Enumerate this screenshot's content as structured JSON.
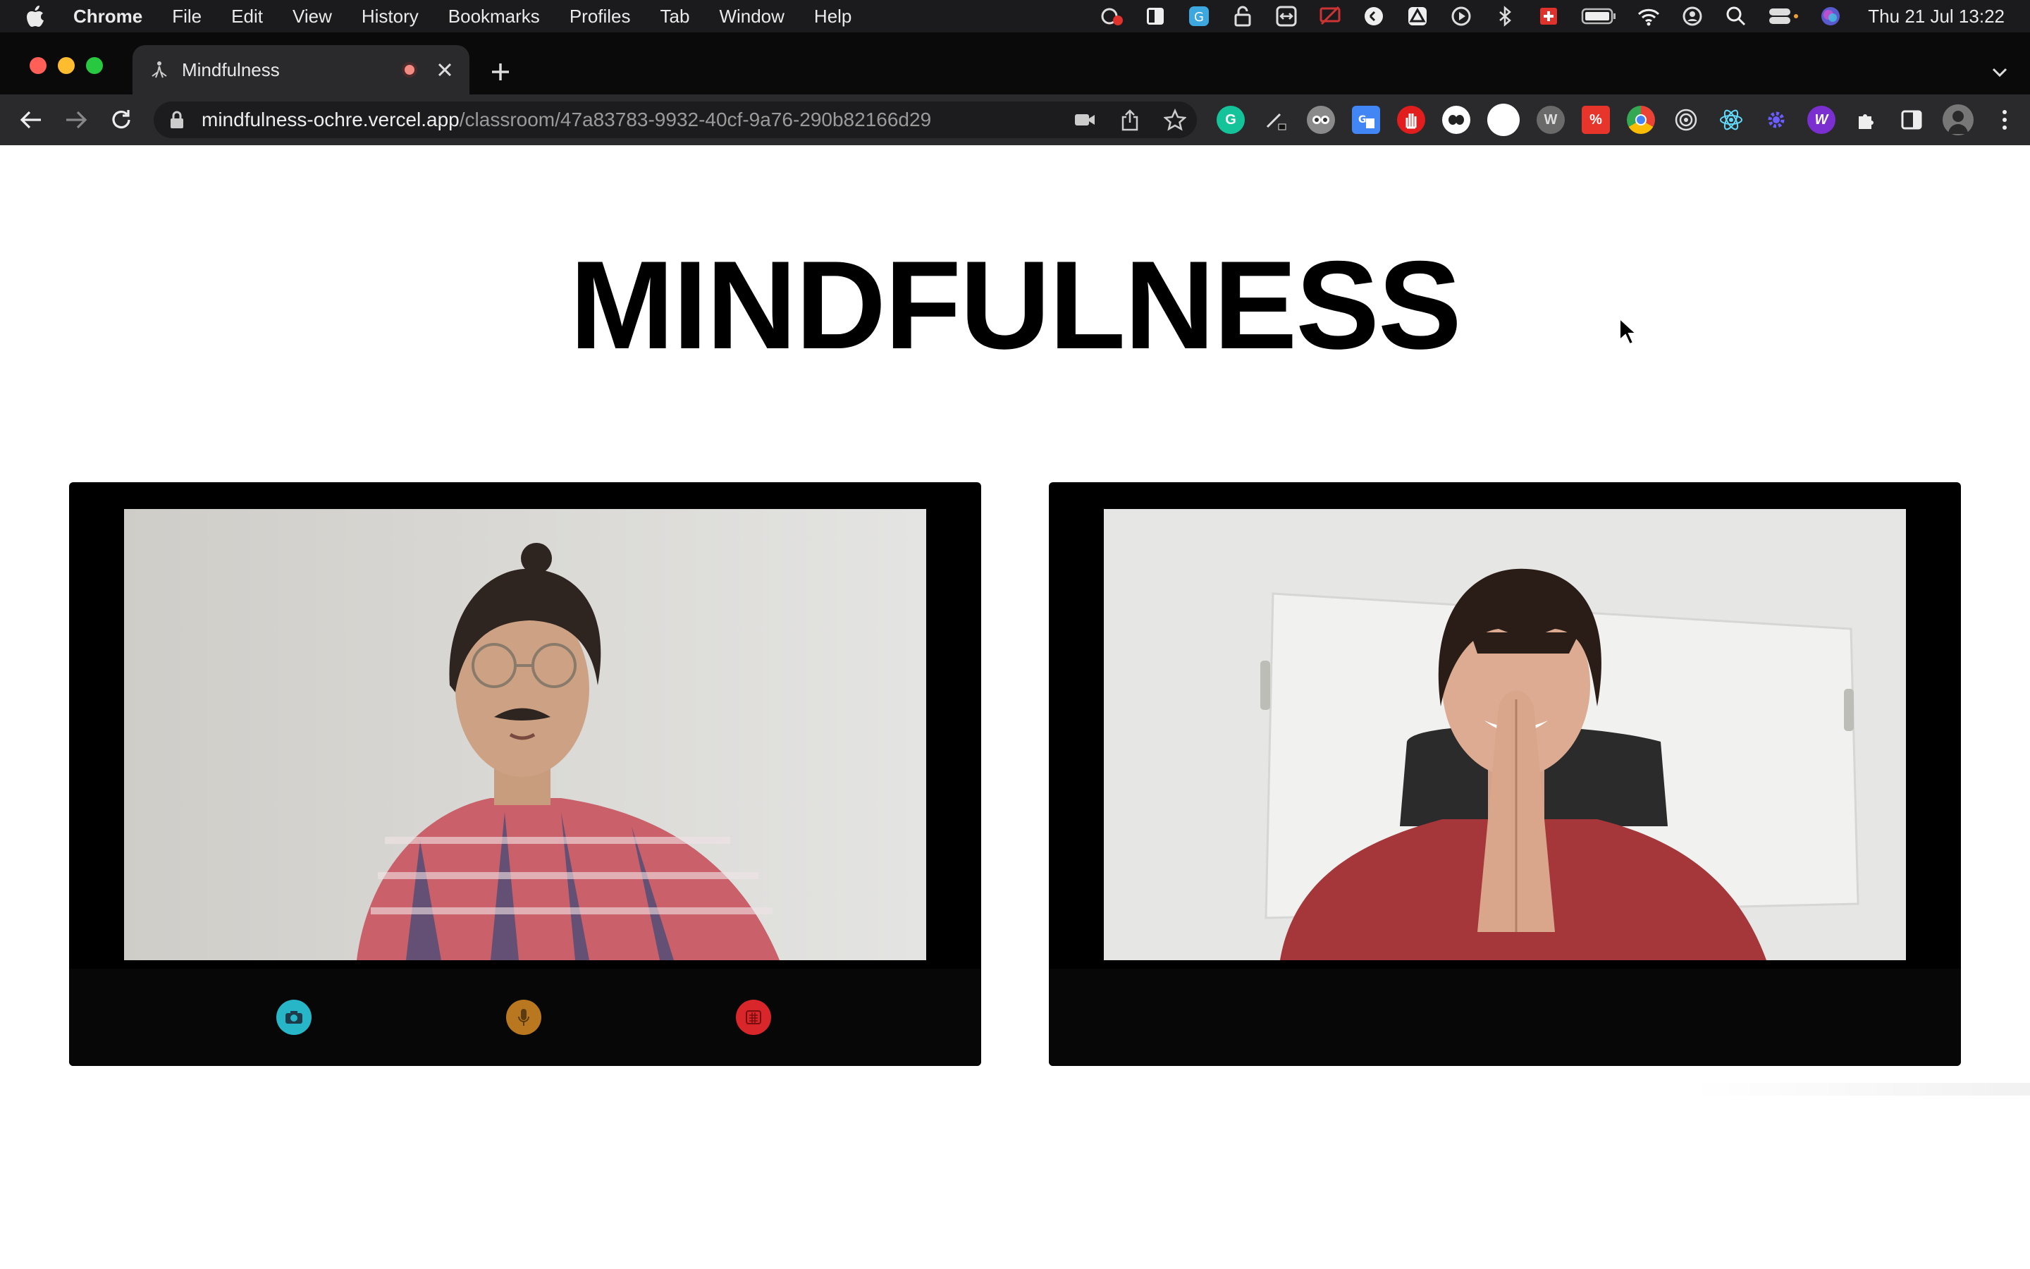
{
  "menubar": {
    "app_name": "Chrome",
    "items": [
      "File",
      "Edit",
      "View",
      "History",
      "Bookmarks",
      "Profiles",
      "Tab",
      "Window",
      "Help"
    ],
    "clock": "Thu 21 Jul  13:22"
  },
  "browser": {
    "tab_title": "Mindfulness",
    "url_host": "mindfulness-ochre.vercel.app",
    "url_path": "/classroom/47a83783-9932-40cf-9a76-290b82166d29",
    "extension_letters": [
      "G",
      "",
      "",
      "",
      "",
      "",
      "",
      "W",
      "%",
      "",
      "",
      "",
      "",
      "W"
    ]
  },
  "page": {
    "title": "MINDFULNESS",
    "participants": [
      {
        "position": "local",
        "controls": [
          "camera",
          "microphone",
          "hang-up"
        ]
      },
      {
        "position": "remote"
      }
    ]
  },
  "colors": {
    "camera_button": "#26b6c8",
    "mic_button": "#b9781f",
    "hangup_button": "#d8262a"
  }
}
